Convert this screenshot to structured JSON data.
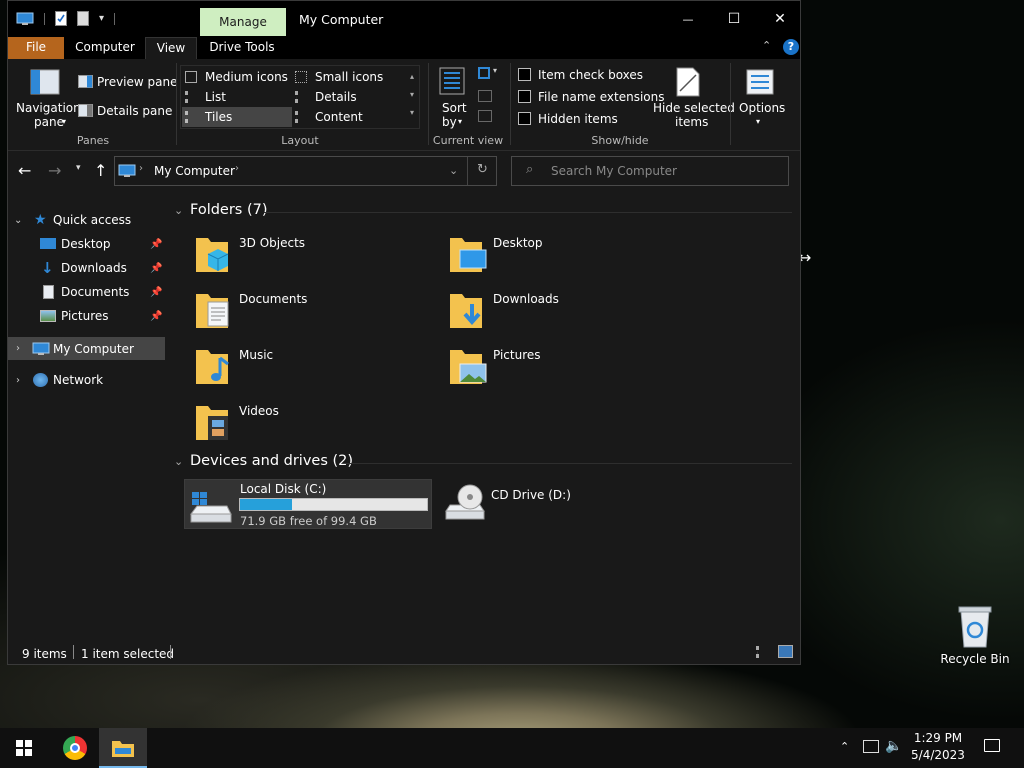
{
  "window": {
    "title": "My Computer",
    "context_tab": "Manage",
    "controls": {
      "minimize": "—",
      "maximize": "☐",
      "close": "✕"
    }
  },
  "ribbon_tabs": [
    "File",
    "Computer",
    "View",
    "Drive Tools"
  ],
  "ribbon": {
    "panes": {
      "navigation_pane_line1": "Navigation",
      "navigation_pane_line2": "pane",
      "preview_pane": "Preview pane",
      "details_pane": "Details pane",
      "group_label": "Panes"
    },
    "layout": {
      "options": [
        "Medium icons",
        "Small icons",
        "List",
        "Details",
        "Tiles",
        "Content"
      ],
      "selected": "Tiles",
      "group_label": "Layout"
    },
    "current_view": {
      "sort_by_line1": "Sort",
      "sort_by_line2": "by",
      "group_label": "Current view"
    },
    "show_hide": {
      "item_check_boxes": "Item check boxes",
      "file_name_extensions": "File name extensions",
      "hidden_items": "Hidden items",
      "hide_selected_line1": "Hide selected",
      "hide_selected_line2": "items",
      "group_label": "Show/hide"
    },
    "options_label": "Options"
  },
  "address": {
    "path": "My Computer",
    "search_placeholder": "Search My Computer"
  },
  "nav_pane": {
    "quick_access": "Quick access",
    "quick_items": [
      "Desktop",
      "Downloads",
      "Documents",
      "Pictures"
    ],
    "my_computer": "My Computer",
    "network": "Network"
  },
  "content": {
    "folders_header": "Folders (7)",
    "folders": [
      "3D Objects",
      "Desktop",
      "Documents",
      "Downloads",
      "Music",
      "Pictures",
      "Videos"
    ],
    "drives_header": "Devices and drives (2)",
    "drives": [
      {
        "name": "Local Disk (C:)",
        "free_text": "71.9 GB free of 99.4 GB",
        "used_fraction": 0.277
      },
      {
        "name": "CD Drive (D:)"
      }
    ]
  },
  "status_bar": {
    "count": "9 items",
    "selected": "1 item selected"
  },
  "desktop": {
    "recycle_bin": "Recycle Bin"
  },
  "taskbar": {
    "time": "1:29 PM",
    "date": "5/4/2023"
  },
  "colors": {
    "accent": "#1a73c8",
    "file_tab": "#b5651d",
    "manage_tab": "#cfeec1",
    "folder": "#f3c24e",
    "selection": "#454545"
  }
}
